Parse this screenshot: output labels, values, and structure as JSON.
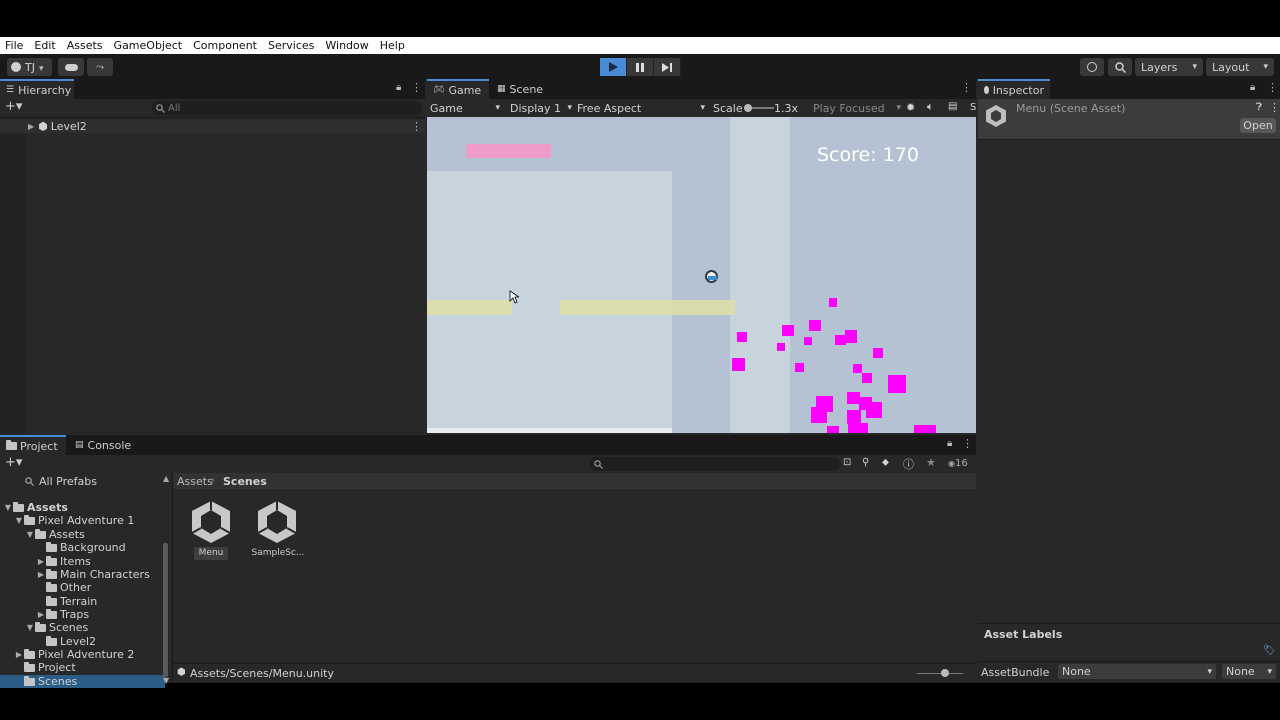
{
  "menubar": [
    "File",
    "Edit",
    "Assets",
    "GameObject",
    "Component",
    "Services",
    "Window",
    "Help"
  ],
  "toolbar": {
    "account": "TJ",
    "layers": "Layers",
    "layout": "Layout"
  },
  "hierarchy": {
    "tab": "Hierarchy",
    "search_placeholder": "All",
    "root": "Level2"
  },
  "game_view": {
    "tabs": [
      "Game",
      "Scene"
    ],
    "mode": "Game",
    "display": "Display 1",
    "aspect": "Free Aspect",
    "scale_label": "Scale",
    "scale_value": "1.3x",
    "play_focused": "Play Focused",
    "score": "Score: 170",
    "colors": {
      "sky": "#b4c2d4",
      "wall": "#c7d4dd",
      "platform": "#e0dfa6",
      "pink": "#f09cc8",
      "particle": "#ff00ff"
    }
  },
  "inspector": {
    "tab": "Inspector",
    "title": "Menu (Scene Asset)",
    "open_button": "Open",
    "asset_labels": "Asset Labels",
    "asset_bundle_label": "AssetBundle",
    "asset_bundle_value": "None",
    "asset_bundle_variant": "None"
  },
  "project": {
    "tabs": [
      "Project",
      "Console"
    ],
    "favorites": "All Prefabs",
    "hidden_count": "16",
    "breadcrumb": [
      "Assets",
      "Scenes"
    ],
    "tree": [
      {
        "label": "Assets",
        "bold": true
      },
      {
        "label": "Pixel Adventure 1"
      },
      {
        "label": "Assets"
      },
      {
        "label": "Background"
      },
      {
        "label": "Items"
      },
      {
        "label": "Main Characters"
      },
      {
        "label": "Other"
      },
      {
        "label": "Terrain"
      },
      {
        "label": "Traps"
      },
      {
        "label": "Scenes"
      },
      {
        "label": "Level2"
      },
      {
        "label": "Pixel Adventure 2"
      },
      {
        "label": "Project"
      },
      {
        "label": "Scenes"
      }
    ],
    "assets": [
      {
        "label": "Menu"
      },
      {
        "label": "SampleSc..."
      }
    ],
    "path": "Assets/Scenes/Menu.unity"
  }
}
